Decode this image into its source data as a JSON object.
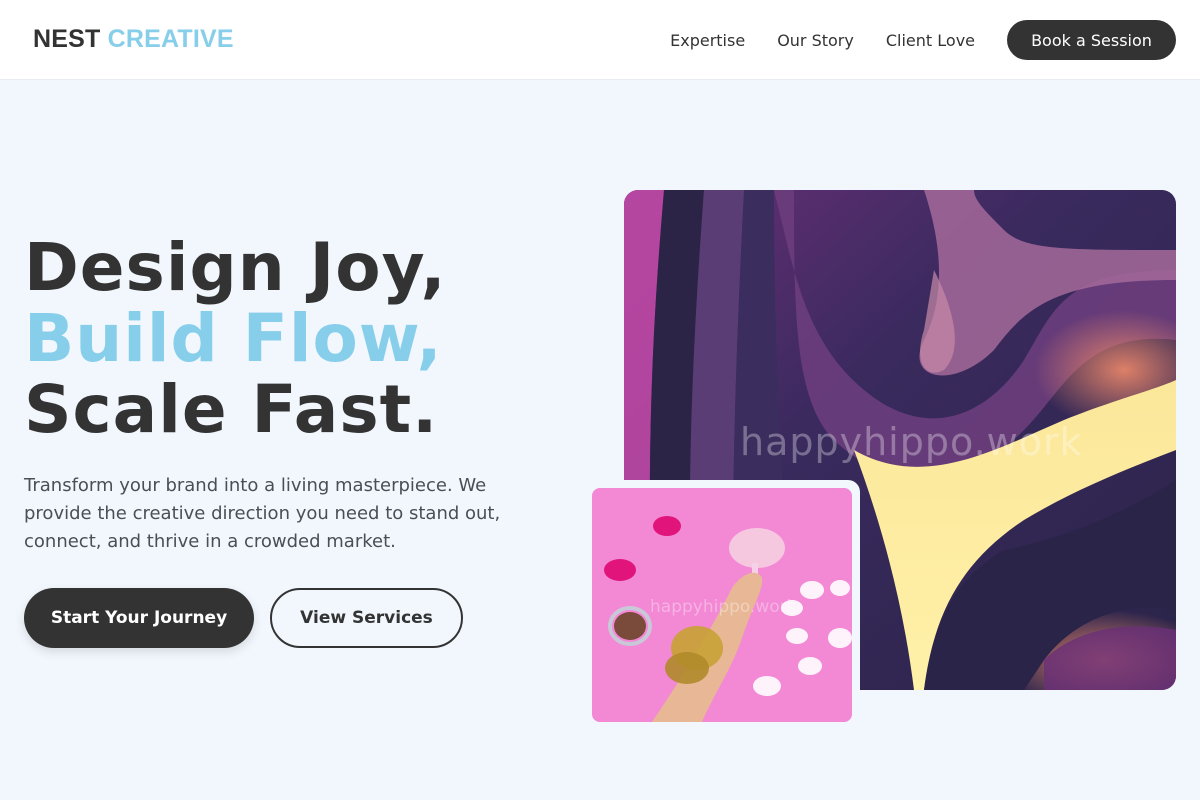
{
  "header": {
    "logo_part1": "NEST",
    "logo_part2": "CREATIVE",
    "nav": [
      "Expertise",
      "Our Story",
      "Client Love"
    ],
    "cta": "Book a Session"
  },
  "hero": {
    "line1": "Design Joy,",
    "line2": "Build Flow,",
    "line3": "Scale Fast.",
    "description": "Transform your brand into a living masterpiece. We provide the creative direction you need to stand out, connect, and thrive in a crowded market.",
    "primary_button": "Start Your Journey",
    "secondary_button": "View Services"
  },
  "images": {
    "main_watermark": "happyhippo.work",
    "small_watermark": "happyhippo.work"
  },
  "colors": {
    "accent": "#87ceeb",
    "dark": "#333333",
    "background": "#f1f7fd"
  }
}
